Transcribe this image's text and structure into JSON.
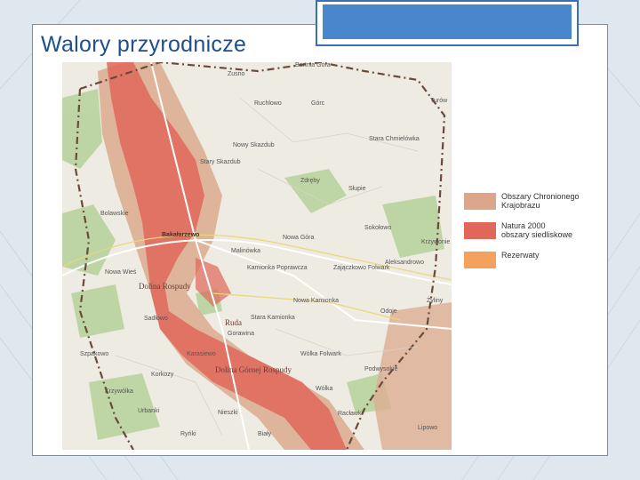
{
  "slide": {
    "title": "Walory przyrodnicze",
    "accent_color": "#3c6fb2"
  },
  "map": {
    "region_labels": [
      {
        "id": "bartnia",
        "text": "Bartnia Góra"
      },
      {
        "id": "zusno",
        "text": "Zusno"
      },
      {
        "id": "turow",
        "text": "Turów"
      },
      {
        "id": "ruchlowo",
        "text": "Ruchlowo"
      },
      {
        "id": "gorc",
        "text": "Górc"
      },
      {
        "id": "nowy-skazdub",
        "text": "Nowy Skazdub"
      },
      {
        "id": "stary-chmielowka",
        "text": "Stara Chmielówka"
      },
      {
        "id": "stary-skazdub",
        "text": "Stary Skazdub"
      },
      {
        "id": "zdreby",
        "text": "Zdręby"
      },
      {
        "id": "slupie",
        "text": "Słupie"
      },
      {
        "id": "bolawskie",
        "text": "Bolawskie"
      },
      {
        "id": "bakalarzewo",
        "text": "Bakałarzewo"
      },
      {
        "id": "sokolowo",
        "text": "Sokołowo"
      },
      {
        "id": "krzywonie",
        "text": "Krzywonie"
      },
      {
        "id": "malinowka",
        "text": "Malinówka"
      },
      {
        "id": "nowa-gora",
        "text": "Nowa Góra"
      },
      {
        "id": "nowa-wies",
        "text": "Nowa Wieś"
      },
      {
        "id": "kamionka-poprawka",
        "text": "Kamionka Poprawcza"
      },
      {
        "id": "zajaczkowo",
        "text": "Zajączkowo\nFolwark"
      },
      {
        "id": "aleksandrowo",
        "text": "Aleksandrowo"
      },
      {
        "id": "dolina-rospudy",
        "text": "Dolina Rospudy"
      },
      {
        "id": "nowa-kaminka",
        "text": "Nowa Kamionka"
      },
      {
        "id": "zyliny",
        "text": "Żyliny"
      },
      {
        "id": "sadlowo",
        "text": "Sadłowo"
      },
      {
        "id": "odoje",
        "text": "Odoje"
      },
      {
        "id": "ruda",
        "text": "Ruda"
      },
      {
        "id": "stara-kaminka",
        "text": "Stara Kamionka"
      },
      {
        "id": "gorawina",
        "text": "Gorawina"
      },
      {
        "id": "szpakowo",
        "text": "Szpakowo"
      },
      {
        "id": "karasiewo",
        "text": "Karasiewo"
      },
      {
        "id": "wolka-folwark",
        "text": "Wólka Folwark"
      },
      {
        "id": "dolina-gornej",
        "text": "Dolina Górnej Rospudy"
      },
      {
        "id": "korkozy",
        "text": "Korkozy"
      },
      {
        "id": "podwysokie",
        "text": "Podwysokie"
      },
      {
        "id": "krzywolka",
        "text": "Krzywólka"
      },
      {
        "id": "wolka",
        "text": "Wólka"
      },
      {
        "id": "urbanki",
        "text": "Urbanki"
      },
      {
        "id": "nieszki",
        "text": "Nieszki"
      },
      {
        "id": "raclawki",
        "text": "Racławki"
      },
      {
        "id": "lipowo",
        "text": "Lipowo"
      },
      {
        "id": "bialy",
        "text": "Biały"
      },
      {
        "id": "rynki",
        "text": "Ryńki"
      }
    ]
  },
  "legend": {
    "items": [
      {
        "label": "Obszary Chronionego\nKrajobrazu",
        "color": "#dca68a"
      },
      {
        "label": "Natura 2000\nobszary siedliskowe",
        "color": "#e0675a"
      },
      {
        "label": "Rezerwaty",
        "color": "#f3a15c"
      }
    ]
  }
}
